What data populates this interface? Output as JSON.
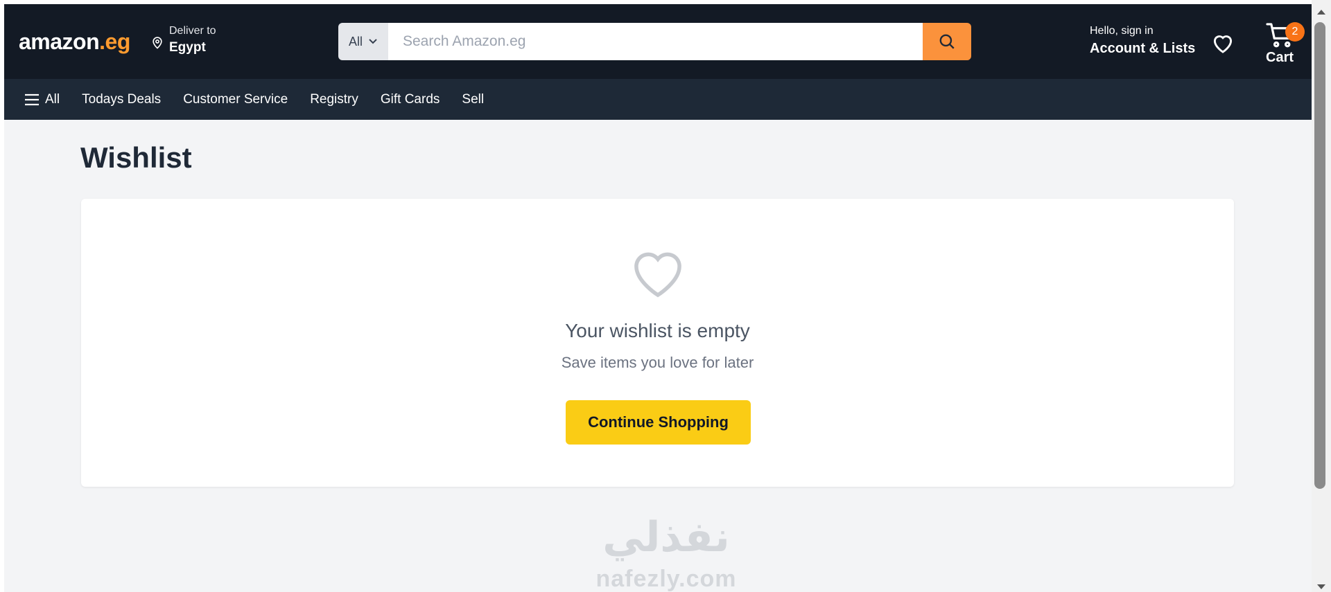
{
  "header": {
    "logo_main": "amazon",
    "logo_tld": ".eg",
    "deliver_label": "Deliver to",
    "deliver_location": "Egypt",
    "search_category": "All",
    "search_placeholder": "Search Amazon.eg",
    "account_greeting": "Hello, sign in",
    "account_label": "Account & Lists",
    "cart_count": "2",
    "cart_label": "Cart"
  },
  "nav": {
    "menu_label": "All",
    "links": [
      "Todays Deals",
      "Customer Service",
      "Registry",
      "Gift Cards",
      "Sell"
    ]
  },
  "page": {
    "title": "Wishlist",
    "empty_title": "Your wishlist is empty",
    "empty_subtitle": "Save items you love for later",
    "cta_label": "Continue Shopping"
  },
  "watermark": {
    "arabic": "نفذلي",
    "latin": "nafezly.com"
  },
  "colors": {
    "header_bg": "#131a25",
    "nav_bg": "#1e2937",
    "accent_orange": "#fb923c",
    "cta_yellow": "#facc15",
    "page_bg": "#f3f4f6"
  },
  "icons": [
    "location-pin-icon",
    "chevron-down-icon",
    "search-icon",
    "heart-icon",
    "cart-icon",
    "hamburger-icon",
    "empty-heart-icon"
  ]
}
